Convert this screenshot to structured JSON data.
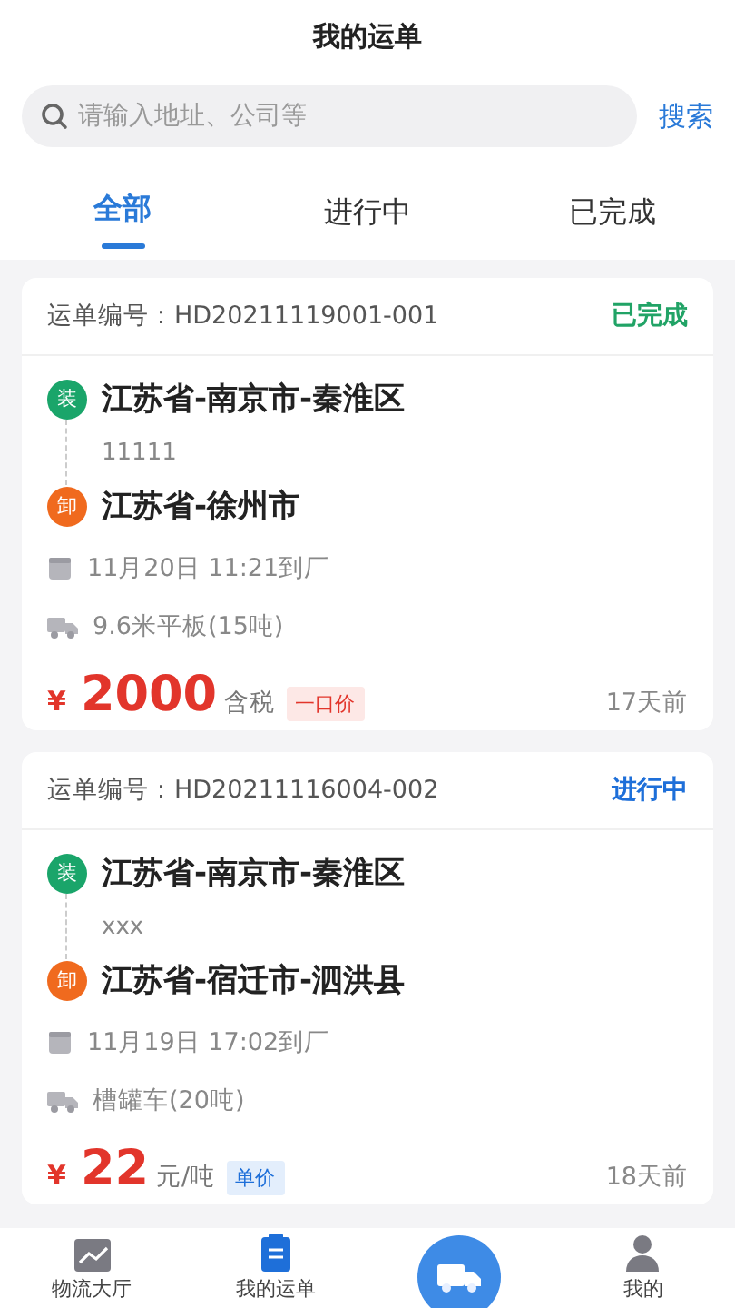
{
  "header": {
    "title": "我的运单"
  },
  "search": {
    "placeholder": "请输入地址、公司等",
    "button": "搜索"
  },
  "tabs": [
    {
      "label": "全部",
      "selected": true
    },
    {
      "label": "进行中",
      "selected": false
    },
    {
      "label": "已完成",
      "selected": false
    }
  ],
  "orders": [
    {
      "number": "运单编号：HD20211119001-001",
      "status": {
        "label": "已完成",
        "kind": "done"
      },
      "load": {
        "badge": "装",
        "address": "江苏省-南京市-秦淮区",
        "detail": "11111"
      },
      "unload": {
        "badge": "卸",
        "address": "江苏省-徐州市"
      },
      "arrival": "11月20日 11:21到厂",
      "vehicle": "9.6米平板(15吨)",
      "currency": "¥",
      "price": "2000",
      "unit": "含税",
      "tag": {
        "label": "一口价",
        "kind": "fixed"
      },
      "age": "17天前"
    },
    {
      "number": "运单编号：HD20211116004-002",
      "status": {
        "label": "进行中",
        "kind": "ongoing"
      },
      "load": {
        "badge": "装",
        "address": "江苏省-南京市-秦淮区",
        "detail": "xxx"
      },
      "unload": {
        "badge": "卸",
        "address": "江苏省-宿迁市-泗洪县"
      },
      "arrival": "11月19日 17:02到厂",
      "vehicle": "槽罐车(20吨)",
      "currency": "¥",
      "price": "22",
      "unit": "元/吨",
      "tag": {
        "label": "单价",
        "kind": "unit"
      },
      "age": "18天前"
    }
  ],
  "nav": [
    {
      "kind": "hall",
      "label": "物流大厅",
      "selected": false
    },
    {
      "kind": "orders",
      "label": "我的运单",
      "selected": true
    },
    {
      "kind": "fab"
    },
    {
      "kind": "me",
      "label": "我的",
      "selected": false
    }
  ]
}
